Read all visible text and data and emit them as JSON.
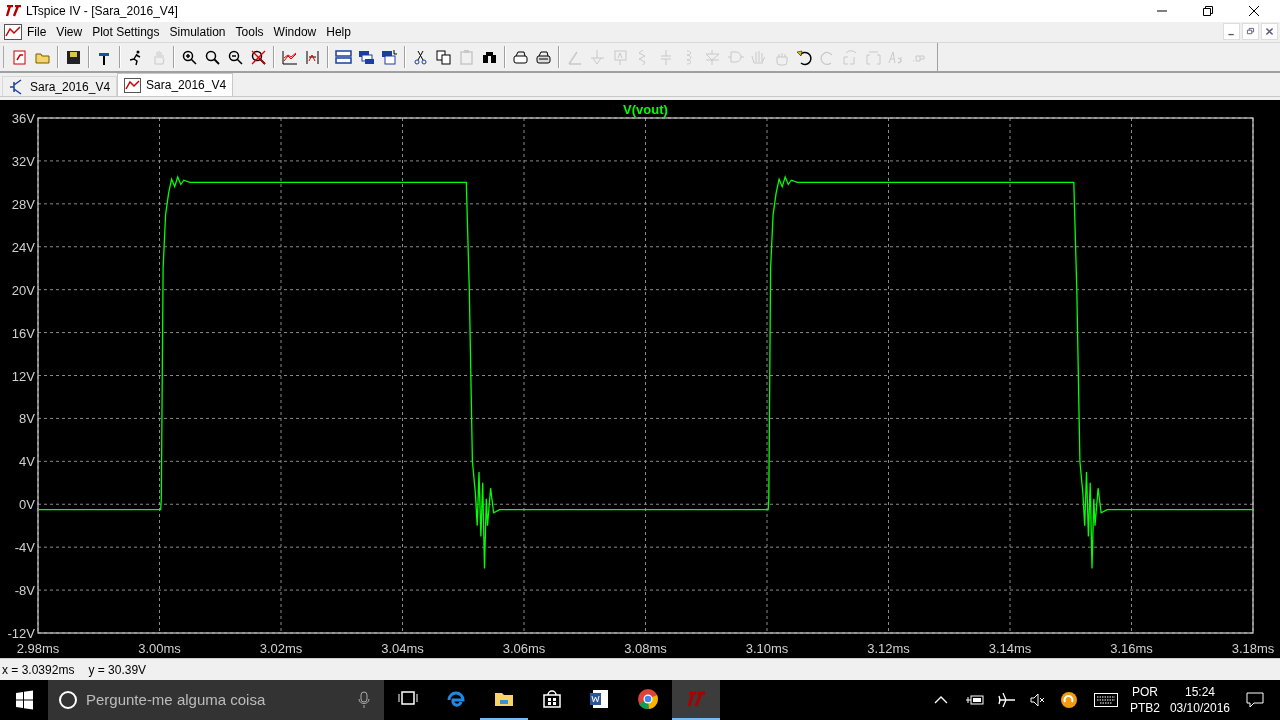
{
  "window": {
    "title": "LTspice IV - [Sara_2016_V4]"
  },
  "menu": [
    "File",
    "View",
    "Plot Settings",
    "Simulation",
    "Tools",
    "Window",
    "Help"
  ],
  "toolbar_groups": [
    [
      {
        "disabled": false
      },
      {
        "disabled": false
      }
    ],
    [
      {
        "disabled": false
      }
    ],
    [
      {
        "disabled": false
      }
    ],
    [
      {
        "disabled": false
      },
      {
        "disabled": true
      }
    ],
    [
      {
        "disabled": false
      },
      {
        "disabled": false
      },
      {
        "disabled": false
      },
      {
        "disabled": false
      }
    ],
    [
      {
        "disabled": false
      },
      {
        "disabled": false
      }
    ],
    [
      {
        "disabled": false
      },
      {
        "disabled": false
      },
      {
        "disabled": false
      }
    ],
    [
      {
        "disabled": false
      },
      {
        "disabled": false
      },
      {
        "disabled": true
      },
      {
        "disabled": false
      }
    ],
    [
      {
        "disabled": false
      },
      {
        "disabled": false
      }
    ],
    [
      {
        "disabled": true
      },
      {
        "disabled": true
      },
      {
        "disabled": true
      },
      {
        "disabled": true
      },
      {
        "disabled": true
      },
      {
        "disabled": true
      },
      {
        "disabled": true
      },
      {
        "disabled": true
      },
      {
        "disabled": true
      },
      {
        "disabled": true
      },
      {
        "disabled": false
      },
      {
        "disabled": true
      },
      {
        "disabled": true
      },
      {
        "disabled": true
      },
      {
        "disabled": true
      },
      {
        "disabled": true
      }
    ]
  ],
  "tabs": [
    {
      "kind": "schematic",
      "label": "Sara_2016_V4",
      "selected": false
    },
    {
      "kind": "waveform",
      "label": "Sara_2016_V4",
      "selected": true
    }
  ],
  "plot": {
    "chart_data": {
      "type": "line",
      "grid": true,
      "x": [
        2.98,
        3.0002,
        3.0003,
        3.0006,
        3.001,
        3.0015,
        3.002,
        3.0025,
        3.003,
        3.0035,
        3.004,
        3.005,
        3.0505,
        3.051,
        3.0515,
        3.052,
        3.0523,
        3.0526,
        3.0529,
        3.0532,
        3.0535,
        3.0538,
        3.054,
        3.0545,
        3.055,
        3.056,
        3.1002,
        3.1003,
        3.1006,
        3.101,
        3.1015,
        3.102,
        3.1025,
        3.103,
        3.1035,
        3.104,
        3.105,
        3.1505,
        3.151,
        3.1515,
        3.152,
        3.1523,
        3.1526,
        3.1529,
        3.1532,
        3.1535,
        3.1538,
        3.154,
        3.1545,
        3.155,
        3.156,
        3.18
      ],
      "series": [
        {
          "name": "V(vout)",
          "color": "#00ff00",
          "values": [
            -0.5,
            -0.5,
            0.5,
            22,
            27,
            29,
            30.3,
            29.6,
            30.5,
            29.8,
            30.2,
            30,
            30,
            20,
            4,
            1,
            -2,
            3,
            -3,
            2,
            -6,
            0.5,
            -2,
            1.5,
            -0.8,
            -0.5,
            -0.5,
            0.5,
            22,
            27,
            29,
            30.3,
            29.6,
            30.5,
            29.8,
            30.2,
            30,
            30,
            20,
            4,
            1,
            -2,
            3,
            -3,
            2,
            -6,
            0.5,
            -2,
            1.5,
            -0.8,
            -0.5,
            -0.5
          ]
        }
      ],
      "xlim": [
        2.98,
        3.18
      ],
      "ylim": [
        -12,
        36
      ],
      "xticks": [
        {
          "value": 2.98,
          "label": "2.98ms"
        },
        {
          "value": 3.0,
          "label": "3.00ms"
        },
        {
          "value": 3.02,
          "label": "3.02ms"
        },
        {
          "value": 3.04,
          "label": "3.04ms"
        },
        {
          "value": 3.06,
          "label": "3.06ms"
        },
        {
          "value": 3.08,
          "label": "3.08ms"
        },
        {
          "value": 3.1,
          "label": "3.10ms"
        },
        {
          "value": 3.12,
          "label": "3.12ms"
        },
        {
          "value": 3.14,
          "label": "3.14ms"
        },
        {
          "value": 3.16,
          "label": "3.16ms"
        },
        {
          "value": 3.18,
          "label": "3.18ms"
        }
      ],
      "yticks": [
        {
          "value": 36,
          "label": "36V"
        },
        {
          "value": 32,
          "label": "32V"
        },
        {
          "value": 28,
          "label": "28V"
        },
        {
          "value": 24,
          "label": "24V"
        },
        {
          "value": 20,
          "label": "20V"
        },
        {
          "value": 16,
          "label": "16V"
        },
        {
          "value": 12,
          "label": "12V"
        },
        {
          "value": 8,
          "label": "8V"
        },
        {
          "value": 4,
          "label": "4V"
        },
        {
          "value": 0,
          "label": "0V"
        },
        {
          "value": -4,
          "label": "-4V"
        },
        {
          "value": -8,
          "label": "-8V"
        },
        {
          "value": -12,
          "label": "-12V"
        }
      ]
    }
  },
  "status_bar": [
    "x = 3.0392ms",
    "y = 30.39V"
  ],
  "taskbar": {
    "search": {
      "placeholder": "Pergunte-me alguma coisa"
    },
    "apps": [
      {
        "kind": "task-view",
        "running": false,
        "active": false
      },
      {
        "kind": "edge",
        "running": false,
        "active": false
      },
      {
        "kind": "explorer",
        "running": true,
        "active": false
      },
      {
        "kind": "store",
        "running": false,
        "active": false
      },
      {
        "kind": "word",
        "running": false,
        "active": false
      },
      {
        "kind": "chrome",
        "running": false,
        "active": false
      },
      {
        "kind": "ltspice",
        "running": true,
        "active": true
      }
    ],
    "language": [
      "POR",
      "PTB2"
    ],
    "clock": {
      "time": "15:24",
      "date": "03/10/2016"
    }
  }
}
